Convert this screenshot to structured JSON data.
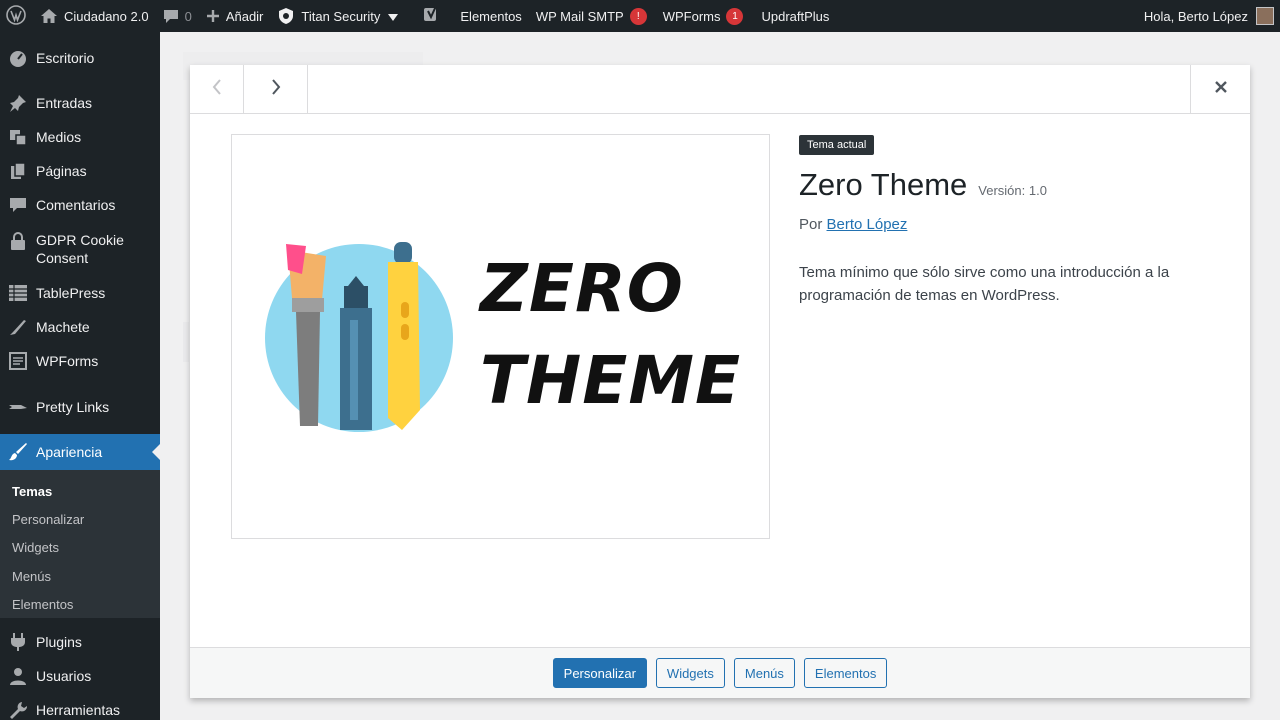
{
  "admin_bar": {
    "site_name": "Ciudadano 2.0",
    "comments_count": "0",
    "add_new": "Añadir",
    "titan": "Titan Security",
    "elementos": "Elementos",
    "wp_mail_smtp": "WP Mail SMTP",
    "wp_mail_badge": "!",
    "wpforms": "WPForms",
    "wpforms_badge": "1",
    "updraft": "UpdraftPlus",
    "greeting": "Hola, Berto López"
  },
  "sidebar": {
    "items": [
      {
        "label": "Escritorio",
        "icon": "dashboard-icon"
      },
      {
        "label": "Entradas",
        "icon": "pushpin-icon"
      },
      {
        "label": "Medios",
        "icon": "media-icon"
      },
      {
        "label": "Páginas",
        "icon": "pages-icon"
      },
      {
        "label": "Comentarios",
        "icon": "comment-icon"
      },
      {
        "label": "GDPR Cookie",
        "label2": "Consent",
        "icon": "lock-icon"
      },
      {
        "label": "TablePress",
        "icon": "table-icon"
      },
      {
        "label": "Machete",
        "icon": "wrench-icon"
      },
      {
        "label": "WPForms",
        "icon": "forms-icon"
      },
      {
        "label": "Pretty Links",
        "icon": "link-icon"
      },
      {
        "label": "Apariencia",
        "icon": "brush-icon"
      },
      {
        "label": "Plugins",
        "icon": "plugin-icon"
      },
      {
        "label": "Usuarios",
        "icon": "users-icon"
      },
      {
        "label": "Herramientas",
        "icon": "tools-icon"
      }
    ],
    "submenu": [
      "Temas",
      "Personalizar",
      "Widgets",
      "Menús",
      "Elementos"
    ]
  },
  "modal": {
    "current_label": "Tema actual",
    "theme_name": "Zero Theme",
    "version": "Versión: 1.0",
    "author_prefix": "Por",
    "author": "Berto López",
    "description": "Tema mínimo que sólo sirve como una introducción a la programación de temas en WordPress.",
    "logo_line1": "ZERO",
    "logo_line2": "THEME",
    "buttons": [
      "Personalizar",
      "Widgets",
      "Menús",
      "Elementos"
    ]
  },
  "colors": {
    "admin_bg": "#1d2327",
    "accent": "#2271b1",
    "badge": "#d63638",
    "circle": "#8fd8f0",
    "brush_tip": "#ff4f8b",
    "pen_blue": "#3d6f8e",
    "pen_yellow": "#ffd23f"
  }
}
